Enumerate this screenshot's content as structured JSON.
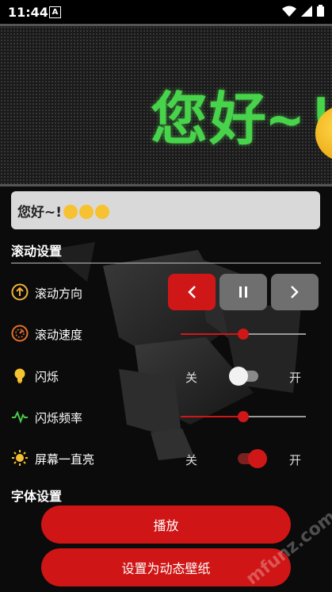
{
  "status_bar": {
    "time": "11:44",
    "notification_letter": "A"
  },
  "led_display": {
    "text": "您好~!"
  },
  "text_input": {
    "value": "您好~!"
  },
  "sections": {
    "scroll_settings": "滚动设置",
    "font_settings": "字体设置"
  },
  "rows": {
    "scroll_direction": {
      "label": "滚动方向"
    },
    "scroll_speed": {
      "label": "滚动速度",
      "level": 0.5
    },
    "flash": {
      "label": "闪烁",
      "off_label": "关",
      "on_label": "开",
      "enabled": false
    },
    "flash_frequency": {
      "label": "闪烁频率",
      "level": 0.5
    },
    "screen_on": {
      "label": "屏幕一直亮",
      "off_label": "关",
      "on_label": "开",
      "enabled": true
    }
  },
  "buttons": {
    "play": "播放",
    "set_wallpaper": "设置为动态壁纸"
  },
  "watermark": "mfunz.com 魔趣网",
  "colors": {
    "accent": "#d01717",
    "led_green": "#47d44a"
  }
}
